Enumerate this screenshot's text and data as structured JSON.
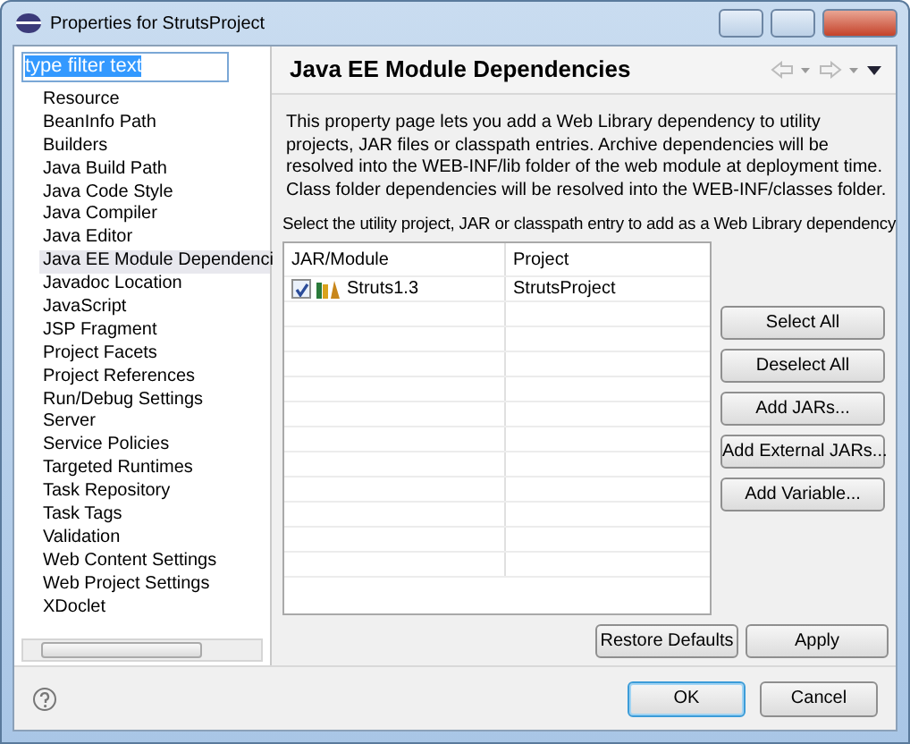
{
  "window": {
    "title": "Properties for StrutsProject"
  },
  "filter": {
    "value": "type filter text"
  },
  "sidebar": {
    "items": [
      {
        "label": "Resource",
        "selected": false
      },
      {
        "label": "BeanInfo Path",
        "selected": false
      },
      {
        "label": "Builders",
        "selected": false
      },
      {
        "label": "Java Build Path",
        "selected": false
      },
      {
        "label": "Java Code Style",
        "selected": false
      },
      {
        "label": "Java Compiler",
        "selected": false
      },
      {
        "label": "Java Editor",
        "selected": false
      },
      {
        "label": "Java EE Module Dependenci",
        "selected": true
      },
      {
        "label": "Javadoc Location",
        "selected": false
      },
      {
        "label": "JavaScript",
        "selected": false
      },
      {
        "label": "JSP Fragment",
        "selected": false
      },
      {
        "label": "Project Facets",
        "selected": false
      },
      {
        "label": "Project References",
        "selected": false
      },
      {
        "label": "Run/Debug Settings",
        "selected": false
      },
      {
        "label": "Server",
        "selected": false
      },
      {
        "label": "Service Policies",
        "selected": false
      },
      {
        "label": "Targeted Runtimes",
        "selected": false
      },
      {
        "label": "Task Repository",
        "selected": false
      },
      {
        "label": "Task Tags",
        "selected": false
      },
      {
        "label": "Validation",
        "selected": false
      },
      {
        "label": "Web Content Settings",
        "selected": false
      },
      {
        "label": "Web Project Settings",
        "selected": false
      },
      {
        "label": "XDoclet",
        "selected": false
      }
    ]
  },
  "page": {
    "title": "Java EE Module Dependencies",
    "description": "This property page lets you add a Web Library dependency to utility projects, JAR files or classpath entries. Archive dependencies will be resolved into the WEB-INF/lib folder of the web module at deployment time. Class folder dependencies will be resolved into the WEB-INF/classes folder.",
    "instruction": "Select the utility project, JAR or classpath entry to add as a Web Library dependency",
    "table": {
      "columns": [
        "JAR/Module",
        "Project"
      ],
      "rows": [
        {
          "module": "Struts1.3",
          "project": "StrutsProject",
          "checked": true
        }
      ]
    },
    "side_buttons": [
      "Select All",
      "Deselect All",
      "Add JARs...",
      "Add External JARs...",
      "Add Variable..."
    ],
    "page_buttons": [
      "Restore Defaults",
      "Apply"
    ]
  },
  "dialog_buttons": [
    {
      "label": "OK",
      "default": true
    },
    {
      "label": "Cancel",
      "default": false
    }
  ]
}
